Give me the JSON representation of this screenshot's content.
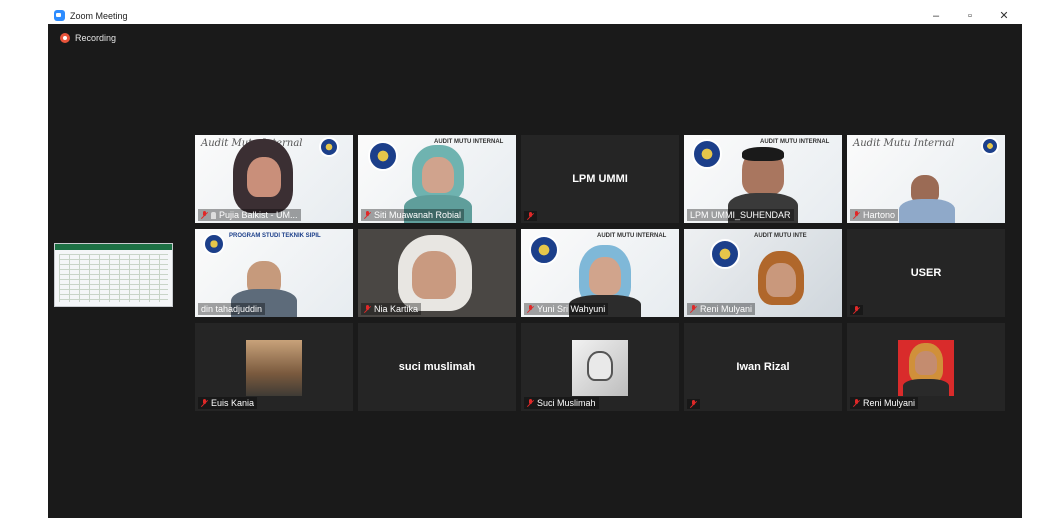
{
  "window": {
    "title": "Zoom Meeting",
    "controls": [
      "–",
      "▫",
      "✕"
    ]
  },
  "recording": {
    "label": "Recording",
    "color": "#e8543b"
  },
  "accent": "#2d8cff",
  "active_speaker_color": "#8fd14f",
  "participants": [
    {
      "name": "Pujia Balkist - UM...",
      "muted": true,
      "pinned": true,
      "slide_text": "Audit Mutu Internal"
    },
    {
      "name": "Siti Muawanah Robial",
      "muted": true,
      "slide_text": "AUDIT MUTU INTERNAL"
    },
    {
      "center_name": "LPM UMMI",
      "muted": true
    },
    {
      "name": "LPM UMMI_SUHENDAR",
      "muted": false,
      "active": true,
      "slide_text": "AUDIT MUTU INTERNAL"
    },
    {
      "name": "Hartono",
      "muted": true,
      "slide_text": "Audit Mutu Internal"
    },
    {
      "name": "din tahadjuddin",
      "muted": false,
      "slide_text": "PROGRAM STUDI TEKNIK SIPIL"
    },
    {
      "name": "Nia Kartika",
      "muted": true
    },
    {
      "name": "Yuni Sri Wahyuni",
      "muted": true,
      "slide_text": "AUDIT MUTU INTERNAL"
    },
    {
      "name": "Reni Mulyani",
      "muted": true,
      "slide_text": "AUDIT MUTU INTE"
    },
    {
      "center_name": "USER",
      "muted": true
    },
    {
      "name": "Euis Kania",
      "muted": true
    },
    {
      "center_name": "suci muslimah",
      "muted": false
    },
    {
      "name": "Suci Muslimah",
      "muted": true
    },
    {
      "center_name": "Iwan Rizal",
      "muted": true
    },
    {
      "name": "Reni Mulyani",
      "muted": true
    }
  ]
}
